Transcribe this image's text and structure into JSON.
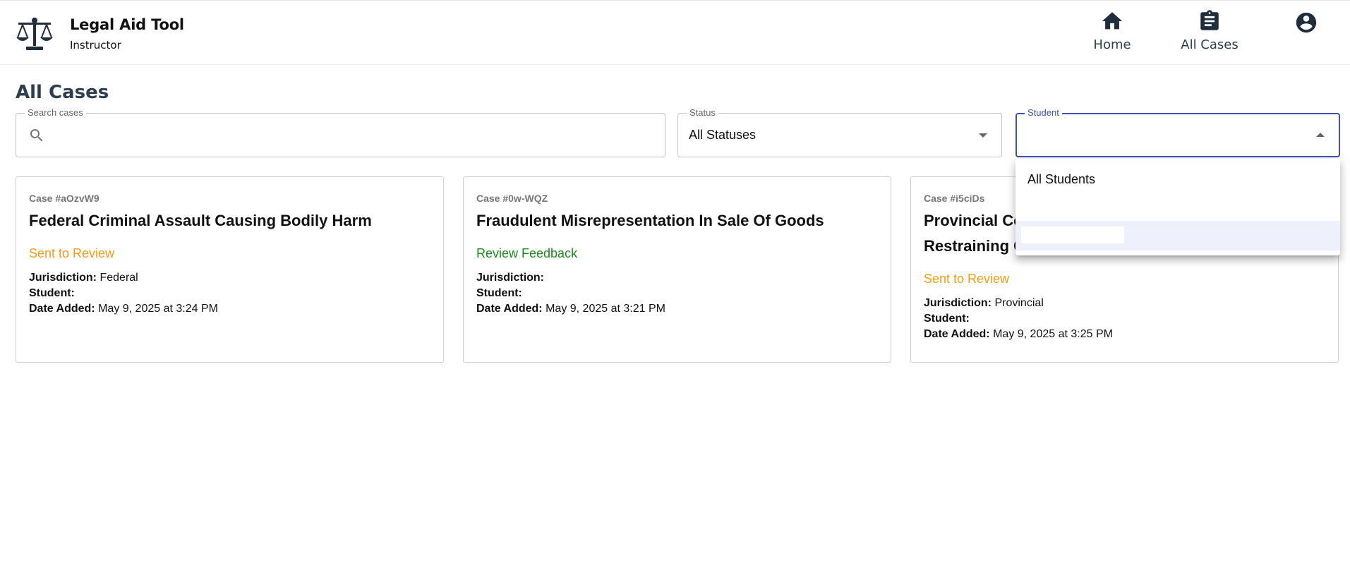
{
  "header": {
    "app_title": "Legal Aid Tool",
    "role": "Instructor",
    "nav": {
      "home_label": "Home",
      "cases_label": "All Cases"
    }
  },
  "page": {
    "title": "All Cases"
  },
  "filters": {
    "search_label": "Search cases",
    "search_value": "",
    "status_label": "Status",
    "status_value": "All Statuses",
    "student_label": "Student",
    "student_value": ""
  },
  "student_dropdown": {
    "options": [
      "All Students",
      "",
      ""
    ]
  },
  "cases": [
    {
      "id": "Case #aOzvW9",
      "title": "Federal Criminal Assault Causing Bodily Harm",
      "status": "Sent to Review",
      "jurisdiction_label": "Jurisdiction:",
      "jurisdiction": "Federal",
      "student_label": "Student:",
      "student": "",
      "date_label": "Date Added:",
      "date": "May 9, 2025 at 3:24 PM"
    },
    {
      "id": "Case #0w-WQZ",
      "title": "Fraudulent Misrepresentation In Sale Of Goods",
      "status": "Review Feedback",
      "jurisdiction_label": "Jurisdiction:",
      "jurisdiction": "",
      "student_label": "Student:",
      "student": "",
      "date_label": "Date Added:",
      "date": "May 9, 2025 at 3:21 PM"
    },
    {
      "id": "Case #i5ciDs",
      "title_line1": "Provincial Co",
      "title_line2": "Restraining C",
      "status": "Sent to Review",
      "jurisdiction_label": "Jurisdiction:",
      "jurisdiction": "Provincial",
      "student_label": "Student:",
      "student": "",
      "date_label": "Date Added:",
      "date": "May 9, 2025 at 3:25 PM"
    }
  ],
  "colors": {
    "accent": "#3f51b5",
    "status_sent": "#f59c12",
    "status_feedback": "#1a8a1a",
    "nav_text": "#2c3e50"
  },
  "icons": [
    "scales-icon",
    "home-icon",
    "clipboard-icon",
    "account-circle-icon",
    "search-icon",
    "dropdown-arrow-icon"
  ]
}
